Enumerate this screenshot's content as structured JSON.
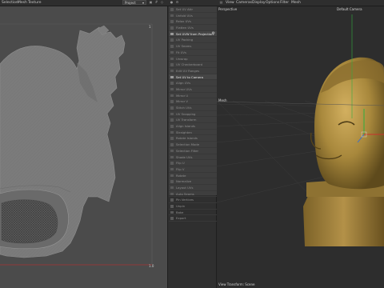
{
  "menubar": {
    "left_menus": [
      "Selection",
      "Mesh",
      "Texture"
    ],
    "project_select": "Project",
    "right_menus": [
      "View",
      "Cameras",
      "Display",
      "Options",
      "Filter",
      "Mesh"
    ]
  },
  "uv_editor": {
    "tick_top_right": "1",
    "tick_bottom_right": "1.0"
  },
  "tools": [
    {
      "label": "Set UV Attr",
      "active": false
    },
    {
      "label": "Unfold UVs",
      "active": false
    },
    {
      "label": "Relax UVs",
      "active": false
    },
    {
      "label": "Flatten UVs",
      "active": false
    },
    {
      "label": "Set UVW from Projection",
      "active": true
    },
    {
      "label": "UV Packing",
      "active": false
    },
    {
      "label": "UV Seams",
      "active": false
    },
    {
      "label": "Fit UVs",
      "active": false
    },
    {
      "label": "Unwrap",
      "active": false
    },
    {
      "label": "UV Checkerboard",
      "active": false
    },
    {
      "label": "Edit UV Ranges",
      "active": false
    },
    {
      "label": "Set UV to Camera",
      "active": true
    },
    {
      "label": "Align UVs",
      "active": false
    },
    {
      "label": "Mirror UVs",
      "active": false
    },
    {
      "label": "Mirror U",
      "active": false
    },
    {
      "label": "Mirror V",
      "active": false
    },
    {
      "label": "Stitch UVs",
      "active": false
    },
    {
      "label": "UV Snapping",
      "active": false
    },
    {
      "label": "UV Transform",
      "active": false
    },
    {
      "label": "Align Islands",
      "active": false
    },
    {
      "label": "Straighten",
      "active": false
    },
    {
      "label": "Rotate Islands",
      "active": false
    },
    {
      "label": "Selection Mode",
      "active": false
    },
    {
      "label": "Selection Filter",
      "active": false
    },
    {
      "label": "Shade UVs",
      "active": false
    },
    {
      "label": "Flip U",
      "active": false
    },
    {
      "label": "Flip V",
      "active": false
    },
    {
      "label": "Rotate",
      "active": false
    },
    {
      "label": "Normalize",
      "active": false
    },
    {
      "label": "Layout UVs",
      "active": false
    },
    {
      "label": "Auto Seams",
      "active": false
    },
    {
      "label": "Pin Vertices",
      "active": false
    },
    {
      "label": "Unpin",
      "active": false
    },
    {
      "label": "Bake",
      "active": false
    },
    {
      "label": "Export",
      "active": false
    }
  ],
  "viewport": {
    "view_label": "Perspective",
    "camera_label": "Default Camera",
    "axis_label": "Mesh",
    "status_text": "View Transform: Scene"
  },
  "colors": {
    "uv_background": "#4b4b4b",
    "uv_island": "#7c7c7c",
    "uv_mesh_dense": "#505050",
    "border_red": "#a63232",
    "bust_gold": "#a8883c",
    "gizmo_green": "#2fae3e",
    "gizmo_red": "#c9322c",
    "gizmo_blue": "#3a6fd1"
  }
}
